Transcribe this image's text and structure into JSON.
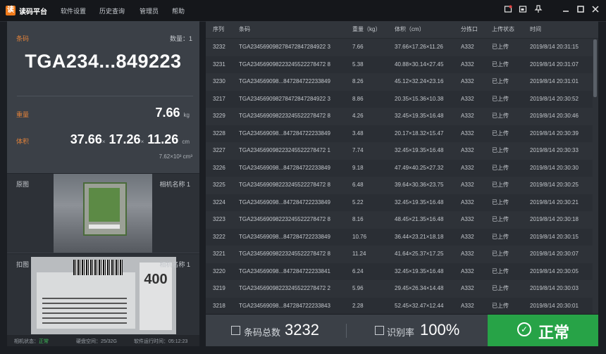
{
  "app": {
    "title": "读码平台",
    "logo": "读"
  },
  "menu": [
    "软件设置",
    "历史查询",
    "管理员",
    "帮助"
  ],
  "window_icons": [
    "alert-icon",
    "screenshot-icon",
    "pin-icon",
    "minimize-icon",
    "maximize-icon",
    "close-icon"
  ],
  "current": {
    "barcode_label": "条码",
    "count_label": "数量：1",
    "barcode": "TGA234...849223",
    "weight_label": "重量",
    "weight_value": "7.66",
    "weight_unit": "kg",
    "volume_label": "体积",
    "dim_l": "37.66",
    "dim_w": "17.26",
    "dim_h": "11.26",
    "dim_unit": "cm",
    "times": "×",
    "volume_total": "7.62×10³ cm³"
  },
  "images": {
    "original_label": "原图",
    "original_camera": "相机名称 1",
    "capture_label": "扣图",
    "capture_camera": "相机名称 1",
    "capture_text": "400"
  },
  "status": {
    "camera": "相机状态：正常",
    "disk": "硬盘空间：25/32G",
    "runtime": "软件运行时间：05:12:23"
  },
  "table": {
    "headers": [
      "序列",
      "条码",
      "重量（kg）",
      "体积（cm）",
      "分拣口",
      "上传状态",
      "时间"
    ],
    "rows": [
      [
        "3232",
        "TGA234569098278472847284922 3",
        "7.66",
        "37.66×17.26×11.26",
        "A332",
        "已上传",
        "2019/8/14 20:31:15"
      ],
      [
        "3231",
        "TGA234569098223245522278472 8",
        "5.38",
        "40.88×30.14×27.45",
        "A332",
        "已上传",
        "2019/8/14 20:31:07"
      ],
      [
        "3230",
        "TGA234569098...847284722233849",
        "8.26",
        "45.12×32.24×23.16",
        "A332",
        "已上传",
        "2019/8/14 20:31:01"
      ],
      [
        "3217",
        "TGA234569098278472847284922 3",
        "8.86",
        "20.35×15.36×10.38",
        "A332",
        "已上传",
        "2019/8/14 20:30:52"
      ],
      [
        "3229",
        "TGA234569098223245522278472 8",
        "4.26",
        "32.45×19.35×16.48",
        "A332",
        "已上传",
        "2019/8/14 20:30:46"
      ],
      [
        "3228",
        "TGA234569098...847284722233849",
        "3.48",
        "20.17×18.32×15.47",
        "A332",
        "已上传",
        "2019/8/14 20:30:39"
      ],
      [
        "3227",
        "TGA234569098223245522278472 1",
        "7.74",
        "32.45×19.35×16.48",
        "A332",
        "已上传",
        "2019/8/14 20:30:33"
      ],
      [
        "3226",
        "TGA234569098...847284722233849",
        "9.18",
        "47.49×40.25×27.32",
        "A332",
        "已上传",
        "2019/8/14 20:30:30"
      ],
      [
        "3225",
        "TGA234569098223245522278472 8",
        "6.48",
        "39.64×30.36×23.75",
        "A332",
        "已上传",
        "2019/8/14 20:30:25"
      ],
      [
        "3224",
        "TGA234569098...847284722233849",
        "5.22",
        "32.45×19.35×16.48",
        "A332",
        "已上传",
        "2019/8/14 20:30:21"
      ],
      [
        "3223",
        "TGA234569098223245522278472 8",
        "8.16",
        "48.45×21.35×16.48",
        "A332",
        "已上传",
        "2019/8/14 20:30:18"
      ],
      [
        "3222",
        "TGA234569098...847284722233849",
        "10.76",
        "36.44×23.21×18.18",
        "A332",
        "已上传",
        "2019/8/14 20:30:15"
      ],
      [
        "3221",
        "TGA234569098223245522278472 8",
        "11.24",
        "41.64×25.37×17.25",
        "A332",
        "已上传",
        "2019/8/14 20:30:07"
      ],
      [
        "3220",
        "TGA234569098...847284722233841",
        "6.24",
        "32.45×19.35×16.48",
        "A332",
        "已上传",
        "2019/8/14 20:30:05"
      ],
      [
        "3219",
        "TGA234569098223245522278472 2",
        "5.96",
        "29.45×26.34×14.48",
        "A332",
        "已上传",
        "2019/8/14 20:30:03"
      ],
      [
        "3218",
        "TGA234569098...847284722233843",
        "2.28",
        "52.45×32.47×12.44",
        "A332",
        "已上传",
        "2019/8/14 20:30:01"
      ]
    ]
  },
  "summary": {
    "total_label": "条码总数",
    "total_value": "3232",
    "rate_label": "识别率",
    "rate_value": "100%",
    "status_label": "正常",
    "status_icon": "check-circle-icon"
  },
  "colors": {
    "accent_orange": "#e0813a",
    "ok_green": "#27a347",
    "status_ok": "#3ec05a"
  }
}
